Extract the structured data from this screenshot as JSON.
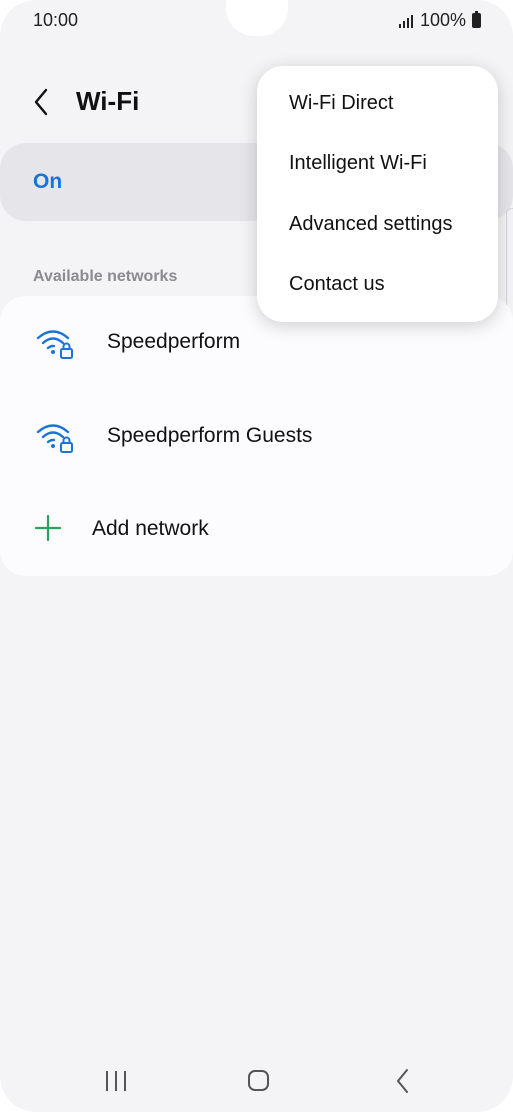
{
  "status_bar": {
    "time": "10:00",
    "battery": "100%"
  },
  "header": {
    "title": "Wi-Fi"
  },
  "master_switch": {
    "label": "On",
    "state": "on",
    "accent_color": "#1a73d9"
  },
  "networks": {
    "section_label": "Available networks",
    "items": [
      {
        "name": "Speedperform",
        "icon": "wifi-locked-icon",
        "secured": true
      },
      {
        "name": "Speedperform Guests",
        "icon": "wifi-locked-icon",
        "secured": true
      }
    ],
    "add_label": "Add network",
    "add_icon": "plus-icon",
    "add_color": "#27a35a"
  },
  "overflow_menu": {
    "items": [
      {
        "label": "Wi-Fi Direct"
      },
      {
        "label": "Intelligent Wi-Fi"
      },
      {
        "label": "Advanced settings"
      },
      {
        "label": "Contact us"
      }
    ]
  },
  "nav_bar": {
    "buttons": [
      "recents-icon",
      "home-icon",
      "back-icon"
    ]
  }
}
